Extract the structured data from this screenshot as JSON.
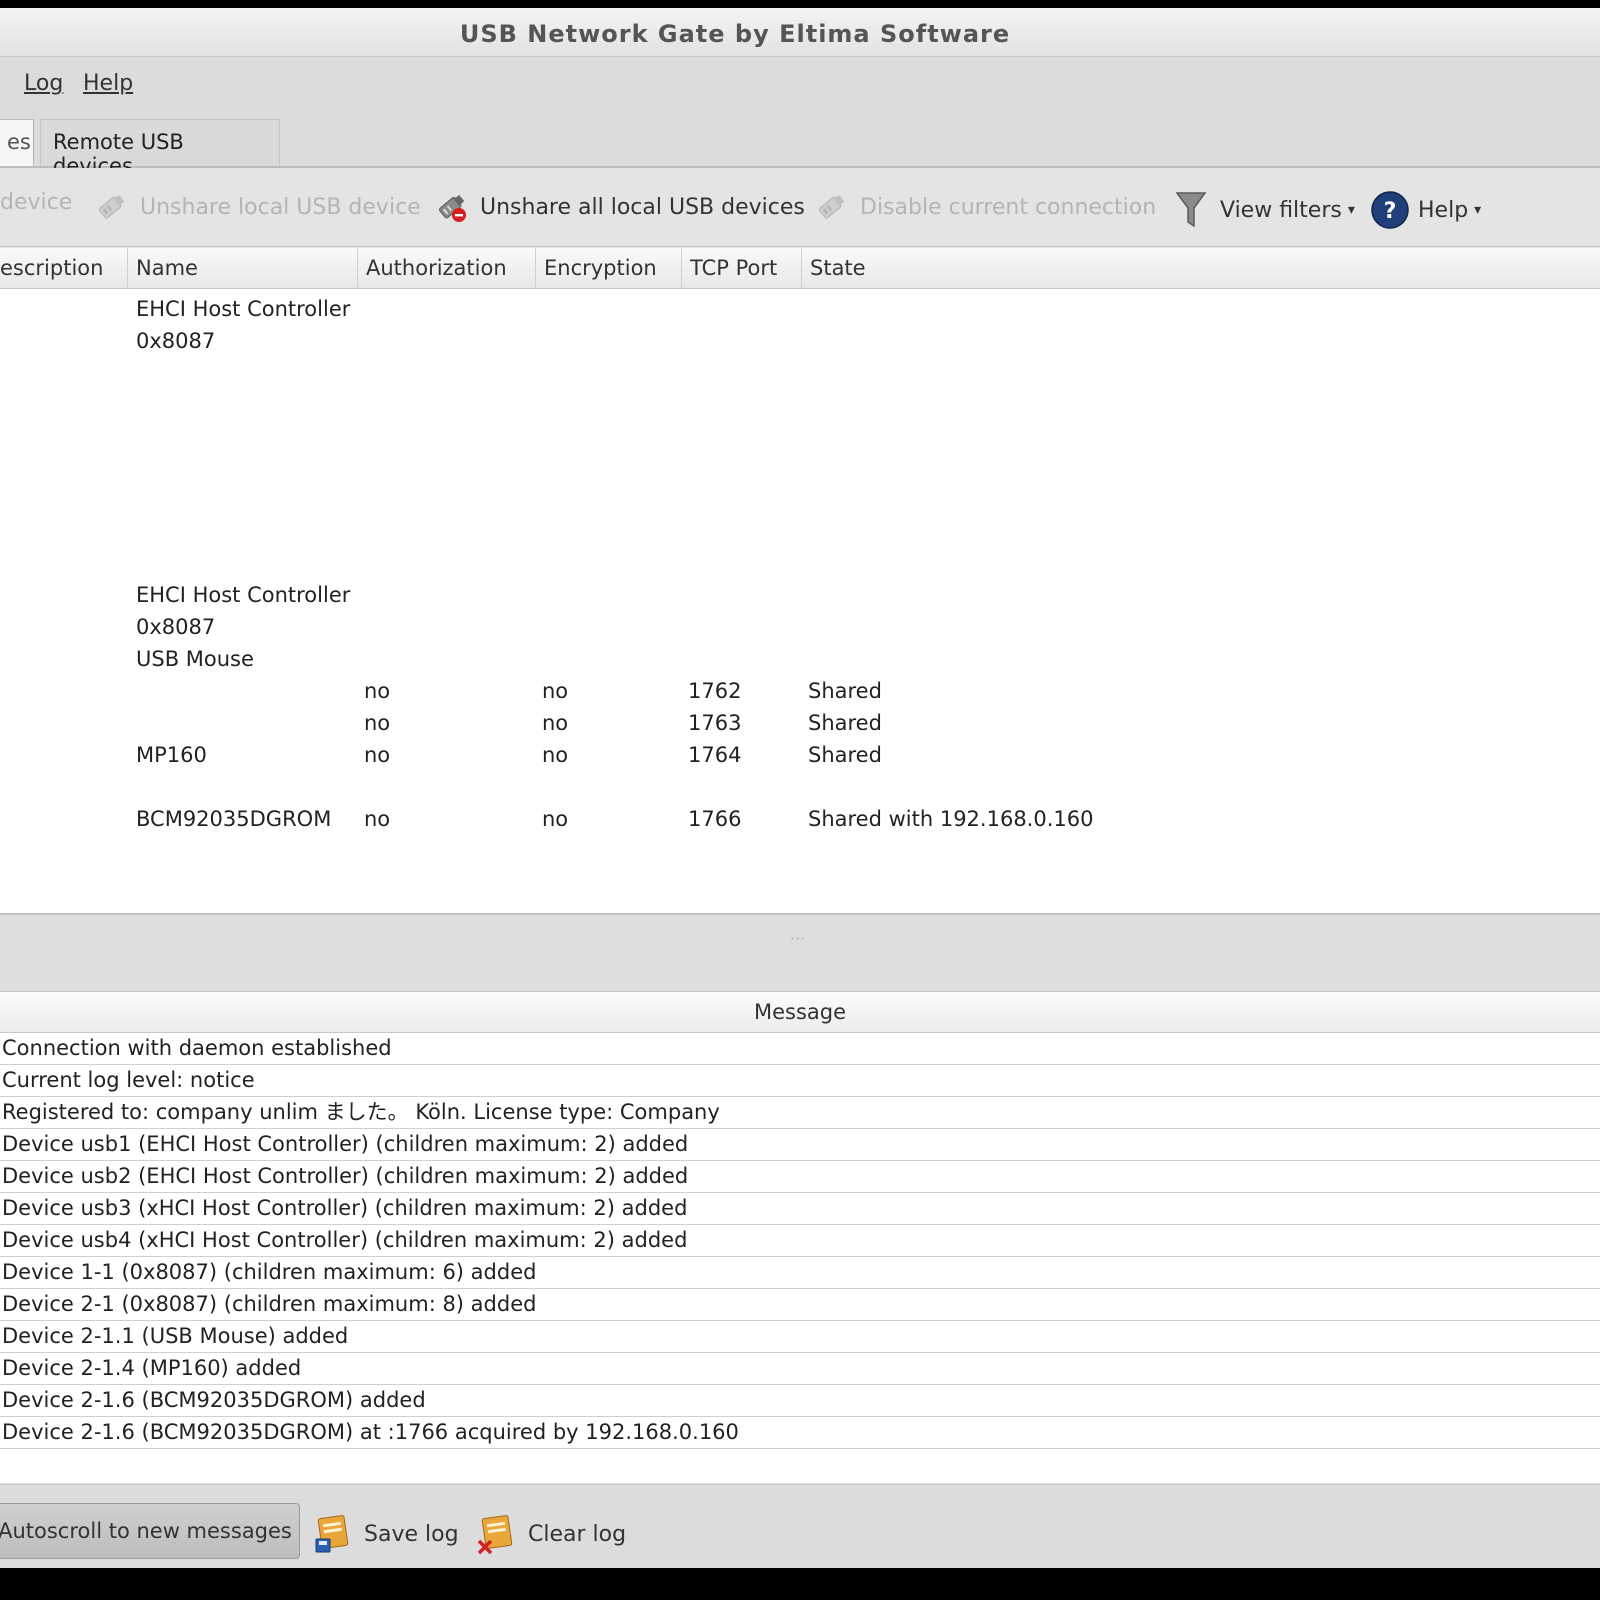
{
  "window": {
    "title": "USB Network Gate by Eltima Software"
  },
  "menu": {
    "items": [
      "Log",
      "Help"
    ]
  },
  "tabs": {
    "active_partial": "es",
    "remote": "Remote USB devices"
  },
  "toolbar": {
    "share_partial": "device",
    "unshare_local": "Unshare local USB device",
    "unshare_all": "Unshare all local USB devices",
    "disable_connection": "Disable current connection",
    "view_filters": "View filters",
    "help": "Help",
    "dropdown_arrow": "▾",
    "help_glyph": "?"
  },
  "columns": {
    "description": "escription",
    "name": "Name",
    "authorization": "Authorization",
    "encryption": "Encryption",
    "tcp_port": "TCP Port",
    "state": "State"
  },
  "devices": [
    {
      "name": "EHCI Host Controller"
    },
    {
      "name": "0x8087"
    },
    {
      "name": "EHCI Host Controller"
    },
    {
      "name": "0x8087"
    },
    {
      "name": "USB Mouse"
    },
    {
      "authorization": "no",
      "encryption": "no",
      "tcp_port": "1762",
      "state": "Shared"
    },
    {
      "authorization": "no",
      "encryption": "no",
      "tcp_port": "1763",
      "state": "Shared"
    },
    {
      "name": "MP160",
      "authorization": "no",
      "encryption": "no",
      "tcp_port": "1764",
      "state": "Shared"
    },
    {
      "name": "BCM92035DGROM",
      "authorization": "no",
      "encryption": "no",
      "tcp_port": "1766",
      "state": "Shared with 192.168.0.160"
    }
  ],
  "splitter": {
    "grip": "···"
  },
  "log": {
    "header": "Message",
    "messages": [
      "Connection with daemon established",
      "Current log level: notice",
      "Registered to: company unlim ました。 Köln. License type: Company",
      "Device usb1 (EHCI Host Controller) (children maximum: 2) added",
      "Device usb2 (EHCI Host Controller) (children maximum: 2) added",
      "Device usb3 (xHCI Host Controller) (children maximum: 2) added",
      "Device usb4 (xHCI Host Controller) (children maximum: 2) added",
      "Device 1-1 (0x8087) (children maximum: 6) added",
      "Device 2-1 (0x8087) (children maximum: 8) added",
      "Device 2-1.1 (USB Mouse) added",
      "Device 2-1.4 (MP160) added",
      "Device 2-1.6 (BCM92035DGROM) added",
      "Device 2-1.6 (BCM92035DGROM) at :1766 acquired by 192.168.0.160"
    ]
  },
  "bottom": {
    "autoscroll": "Autoscroll to new messages",
    "save_log": "Save log",
    "clear_log": "Clear log"
  }
}
